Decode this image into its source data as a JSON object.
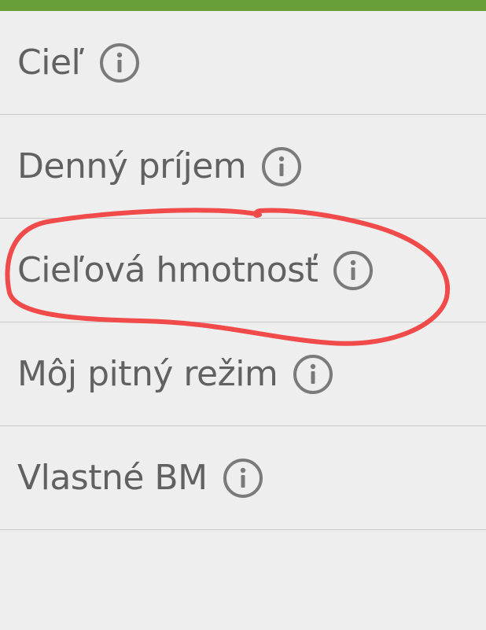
{
  "header": {
    "color": "#689f38"
  },
  "settings": {
    "items": [
      {
        "label": "Cieľ",
        "icon": "info-icon"
      },
      {
        "label": "Denný príjem",
        "icon": "info-icon"
      },
      {
        "label": "Cieľová hmotnosť",
        "icon": "info-icon"
      },
      {
        "label": "Môj pitný režim",
        "icon": "info-icon"
      },
      {
        "label": "Vlastné BM",
        "icon": "info-icon"
      }
    ]
  },
  "annotation": {
    "type": "hand-drawn-circle",
    "color": "#f04a4a",
    "target": "Cieľová hmotnosť"
  }
}
